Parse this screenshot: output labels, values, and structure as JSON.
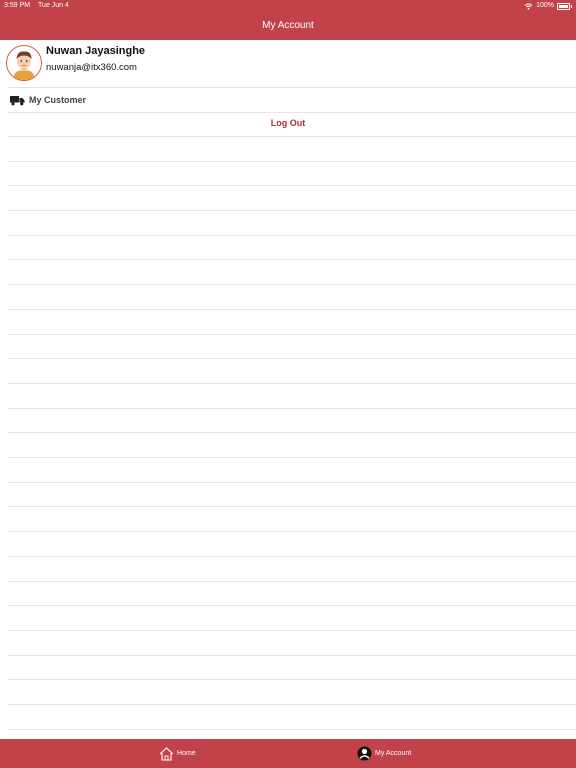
{
  "status_bar": {
    "time": "3:59 PM",
    "date": "Tue Jun 4",
    "battery": "100%"
  },
  "nav": {
    "title": "My Account"
  },
  "profile": {
    "name": "Nuwan Jayasinghe",
    "email": "nuwanja@itx360.com"
  },
  "menu": {
    "customer_label": "My Customer",
    "logout_label": "Log Out"
  },
  "tabs": [
    {
      "label": "Home"
    },
    {
      "label": "My Account"
    }
  ],
  "colors": {
    "brand": "#c2424a",
    "logout": "#b52a3a"
  }
}
